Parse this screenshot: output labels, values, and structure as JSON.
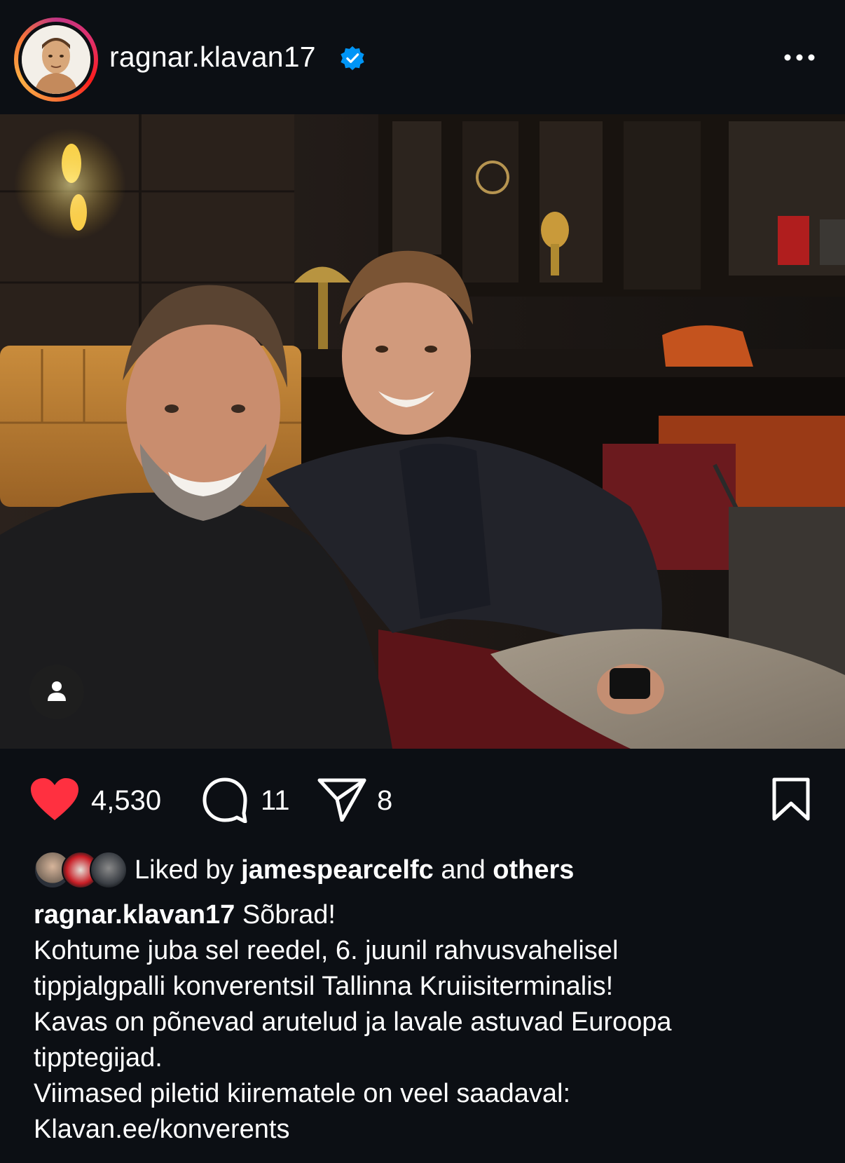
{
  "header": {
    "username": "ragnar.klavan17",
    "verified": true,
    "more_icon": "more-horizontal-icon"
  },
  "post": {
    "tag_icon": "person-icon"
  },
  "actions": {
    "likes": "4,530",
    "comments": "11",
    "shares": "8",
    "liked": true,
    "like_color": "#ff3040"
  },
  "liked_by": {
    "prefix": "Liked by",
    "user": "jamespearcelfc",
    "connector": "and",
    "suffix": "others"
  },
  "caption": {
    "username": "ragnar.klavan17",
    "first": "Sõbrad!",
    "lines": [
      "Kohtume juba sel reedel, 6. juunil rahvusvahelisel",
      "tippjalgpalli konverentsil Tallinna Kruiisiterminalis!",
      "Kavas on põnevad arutelud ja lavale astuvad Euroopa",
      "tipptegijad.",
      "Viimased piletid kiirematele on veel saadaval:",
      "Klavan.ee/konverents"
    ]
  }
}
